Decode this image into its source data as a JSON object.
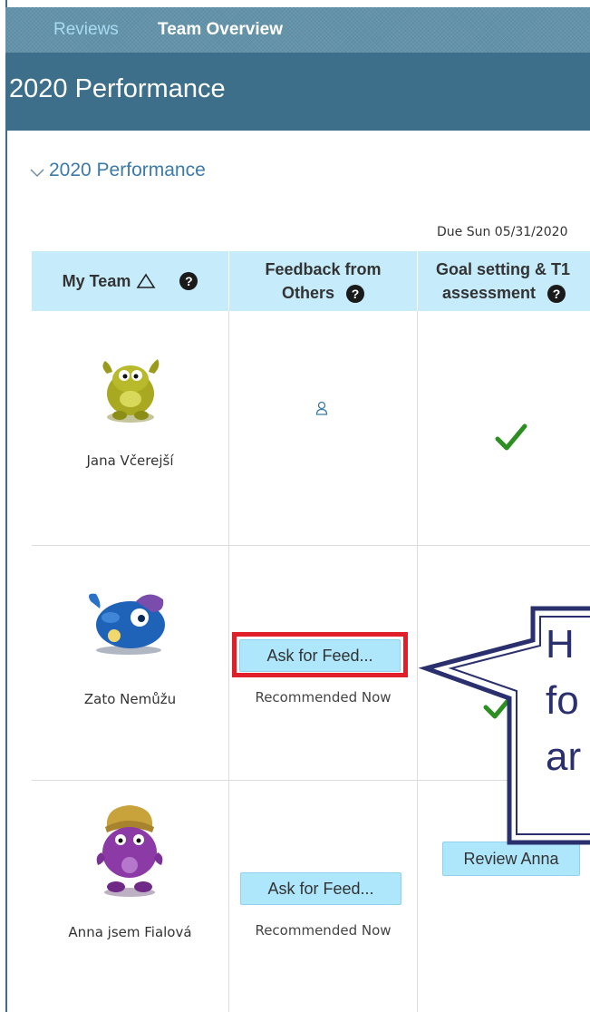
{
  "topnav": {
    "tabs": [
      {
        "label": "Reviews"
      },
      {
        "label": "Team Overview"
      }
    ]
  },
  "page": {
    "title": "2020 Performance"
  },
  "section": {
    "title": "2020 Performance"
  },
  "table": {
    "due_label": "Due Sun 05/31/2020",
    "headers": {
      "team": "My Team",
      "feedback_line1": "Feedback from",
      "feedback_line2": "Others",
      "goal_line1": "Goal setting & T1",
      "goal_line2": "assessment"
    },
    "help_glyph": "?",
    "rows": [
      {
        "name": "Jana Včerejší",
        "feedback": "person-icon",
        "goal": "check"
      },
      {
        "name": "Zato Nemůžu",
        "ask_label": "Ask for Feed...",
        "recommended": "Recommended Now",
        "goal": "check"
      },
      {
        "name": "Anna jsem Fialová",
        "ask_label": "Ask for Feed...",
        "recommended": "Recommended Now",
        "review_label": "Review Anna"
      }
    ]
  },
  "callout": {
    "lines": [
      "H",
      "fo",
      "ar"
    ]
  },
  "colors": {
    "nav_bg": "#5d8da4",
    "title_bg": "#3e6f8a",
    "header_bg": "#c6ecfb",
    "button_bg": "#aee6fb",
    "check_green": "#2d8f22",
    "highlight_red": "#e11f2a",
    "callout_navy": "#2a2f6e"
  }
}
